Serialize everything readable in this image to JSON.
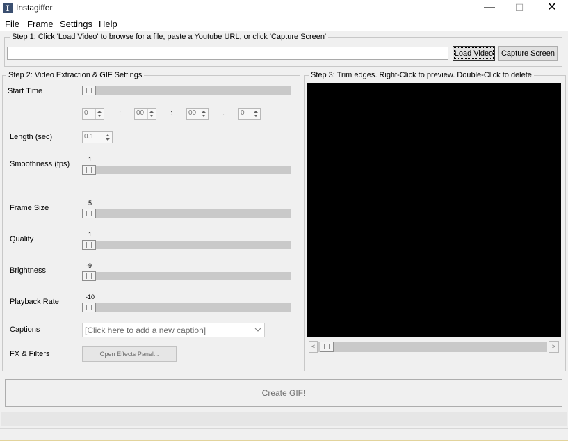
{
  "window": {
    "title": "Instagiffer",
    "app_icon_letter": "I",
    "minimize": "—",
    "maximize": "☐",
    "close": "✕"
  },
  "menu": [
    "File",
    "Frame",
    "Settings",
    "Help"
  ],
  "step1": {
    "legend": "Step 1: Click 'Load Video' to browse for a file, paste a Youtube URL, or click 'Capture Screen'",
    "url_value": "",
    "load_button": "Load Video",
    "capture_button": "Capture Screen"
  },
  "step2": {
    "legend": "Step 2: Video Extraction & GIF Settings",
    "start_time": {
      "label": "Start Time",
      "slider_fraction": 0,
      "spinners": [
        "0",
        "00",
        "00",
        "0"
      ],
      "separators": [
        ":",
        ":",
        "."
      ]
    },
    "length": {
      "label": "Length (sec)",
      "value": "0.1"
    },
    "smoothness": {
      "label": "Smoothness (fps)",
      "value": "1",
      "slider_fraction": 0
    },
    "frame_size": {
      "label": "Frame Size",
      "value": "5",
      "slider_fraction": 0
    },
    "quality": {
      "label": "Quality",
      "value": "1",
      "slider_fraction": 0
    },
    "brightness": {
      "label": "Brightness",
      "value": "-9",
      "slider_fraction": 0
    },
    "playback_rate": {
      "label": "Playback Rate",
      "value": "-10",
      "slider_fraction": 0
    },
    "captions": {
      "label": "Captions",
      "selected": "[Click here to add a new caption]"
    },
    "fx": {
      "label": "FX & Filters",
      "button": "Open Effects Panel..."
    }
  },
  "step3": {
    "legend": "Step 3: Trim edges. Right-Click to preview. Double-Click to delete",
    "scroll_left": "<",
    "scroll_right": ">",
    "scroll_fraction": 0
  },
  "create_button": "Create GIF!",
  "colors": {
    "preview_background": "#000000",
    "window_background": "#f0f0f0"
  }
}
